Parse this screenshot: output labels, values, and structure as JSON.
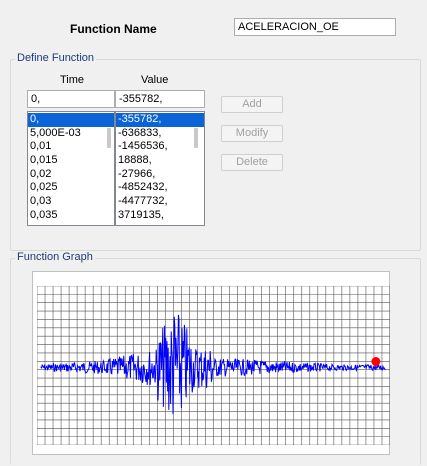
{
  "function_name": {
    "label": "Function Name",
    "value": "ACELERACION_OE"
  },
  "define_function": {
    "title": "Define Function",
    "time_header": "Time",
    "value_header": "Value",
    "time_input": "0,",
    "value_input": "-355782,",
    "time_rows": [
      "0,",
      "5,000E-03",
      "0,01",
      "0,015",
      "0,02",
      "0,025",
      "0,03",
      "0,035"
    ],
    "value_rows": [
      "-355782,",
      "-636833,",
      "-1456536,",
      "18888,",
      "-27966,",
      "-4852432,",
      "-4477732,",
      "3719135,"
    ],
    "selected_row": 0,
    "buttons": {
      "add": "Add",
      "modify": "Modify",
      "delete": "Delete"
    }
  },
  "function_graph": {
    "title": "Function Graph",
    "grid_cols": 44,
    "grid_rows": 19,
    "baseline_row_fraction": 0.5,
    "trace_color": "#0000ff",
    "marker_color": "#ff0000",
    "marker_position_fraction": 0.96
  },
  "colors": {
    "accent_title": "#1c3b7a",
    "selection": "#0a64d8",
    "disabled_text": "#a0a0a0"
  }
}
